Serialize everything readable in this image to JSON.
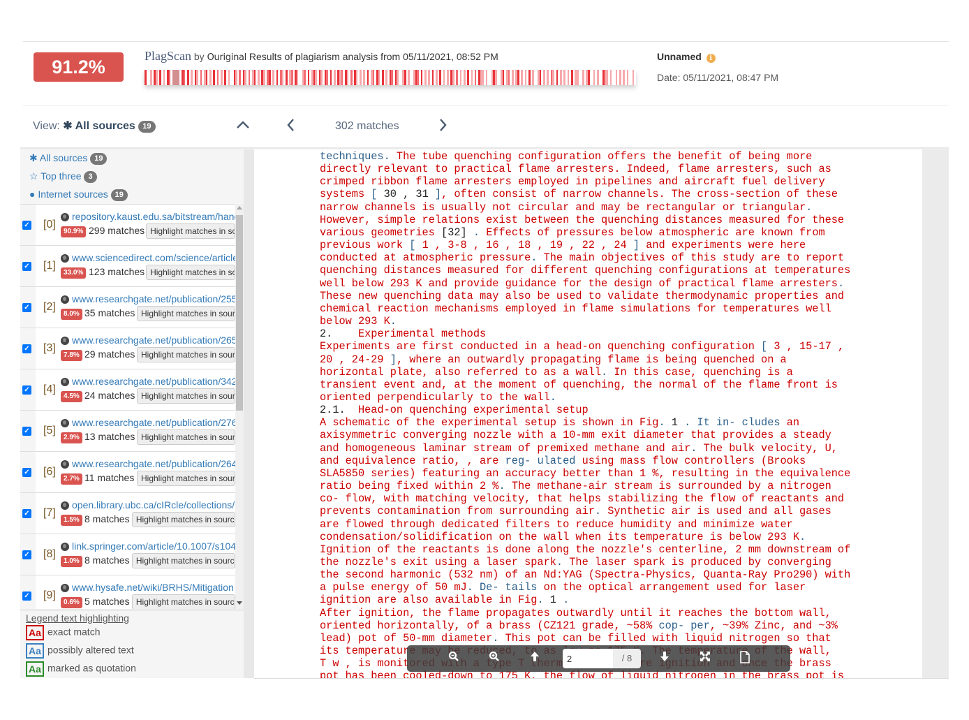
{
  "header": {
    "score": "91.2%",
    "brand_logo": "PlagScan",
    "brand_by": "by",
    "brand_ouriginal": "Ouriginal",
    "results_text": "Results of plagiarism analysis from 05/11/2021, 08:52 PM",
    "doc_name": "Unnamed",
    "info_icon": "info-icon",
    "doc_date": "Date: 05/11/2021, 08:47 PM",
    "heatbar_colors": {
      "strong": "#e8343a",
      "medium": "#f36d73",
      "light": "#f7a9ac",
      "grey": "#d48f91",
      "none": "#ffffff"
    }
  },
  "toolbar": {
    "view_prefix": "View:",
    "view_icon": "asterisk-icon",
    "view_value": "All sources",
    "view_count": "19",
    "collapse_icon": "chevron-up-icon",
    "prev_icon": "chevron-left-icon",
    "matches": "302 matches",
    "next_icon": "chevron-right-icon"
  },
  "filters": [
    {
      "icon": "✱",
      "label": "All sources",
      "count": "19"
    },
    {
      "icon": "☆",
      "label": "Top three",
      "count": "3"
    },
    {
      "icon": "●",
      "label": "Internet sources",
      "count": "19"
    }
  ],
  "sources": [
    {
      "index": "[0]",
      "url": "repository.kaust.edu.sa/bitstream/handle",
      "percent": "90.9%",
      "matches": "299 matches",
      "button": "Highlight matches in source",
      "checked": true
    },
    {
      "index": "[1]",
      "url": "www.sciencedirect.com/science/article",
      "percent": "33.0%",
      "matches": "123 matches",
      "button": "Highlight matches in source",
      "checked": true
    },
    {
      "index": "[2]",
      "url": "www.researchgate.net/publication/255",
      "percent": "8.0%",
      "matches": "35 matches",
      "button": "Highlight matches in source",
      "checked": true
    },
    {
      "index": "[3]",
      "url": "www.researchgate.net/publication/265",
      "percent": "7.8%",
      "matches": "29 matches",
      "button": "Highlight matches in source",
      "checked": true
    },
    {
      "index": "[4]",
      "url": "www.researchgate.net/publication/342",
      "percent": "4.5%",
      "matches": "24 matches",
      "button": "Highlight matches in source",
      "checked": true
    },
    {
      "index": "[5]",
      "url": "www.researchgate.net/publication/276",
      "percent": "2.9%",
      "matches": "13 matches",
      "button": "Highlight matches in source",
      "checked": true
    },
    {
      "index": "[6]",
      "url": "www.researchgate.net/publication/264",
      "percent": "2.7%",
      "matches": "11 matches",
      "button": "Highlight matches in source",
      "checked": true
    },
    {
      "index": "[7]",
      "url": "open.library.ubc.ca/cIRcle/collections/",
      "percent": "1.5%",
      "matches": "8 matches",
      "button": "Highlight matches in source",
      "checked": true
    },
    {
      "index": "[8]",
      "url": "link.springer.com/article/10.1007/s104",
      "percent": "1.0%",
      "matches": "8 matches",
      "button": "Highlight matches in source",
      "checked": true
    },
    {
      "index": "[9]",
      "url": "www.hysafe.net/wiki/BRHS/Mitigation",
      "percent": "0.6%",
      "matches": "5 matches",
      "button": "Highlight matches in source",
      "checked": true
    }
  ],
  "legend": {
    "title": "Legend text highlighting",
    "sample": "Aa",
    "items": [
      {
        "label": "exact match",
        "color": "#cc0000"
      },
      {
        "label": "possibly altered text",
        "color": "#3a7fc0"
      },
      {
        "label": "marked as quotation",
        "color": "#2a8a2a"
      }
    ]
  },
  "document": {
    "lines": [
      [
        [
          "b",
          "techniques."
        ],
        [
          "r",
          " The tube quenching configuration offers the benefit of being more"
        ]
      ],
      [
        [
          "r",
          "directly relevant to practical flame arresters. Indeed, flame arresters, such as"
        ]
      ],
      [
        [
          "r",
          "crimped ribbon flame arresters employed in pipelines and aircraft fuel delivery"
        ]
      ],
      [
        [
          "r",
          "systems "
        ],
        [
          "b",
          "["
        ],
        [
          "k",
          " 30 , 31 "
        ],
        [
          "b",
          "]"
        ],
        [
          "r",
          ", often consist of narrow channels. The cross-section of these"
        ]
      ],
      [
        [
          "r",
          "narrow channels is usually not circular and may be rectangular or triangular"
        ],
        [
          "b",
          "."
        ]
      ],
      [
        [
          "r",
          "However, simple relations exist between the quenching distances measured for these"
        ]
      ],
      [
        [
          "r",
          "various geometries "
        ],
        [
          "k",
          "[32] "
        ],
        [
          "b",
          "."
        ],
        [
          "r",
          " Effects of pressures below atmospheric are known from"
        ]
      ],
      [
        [
          "r",
          "previous work "
        ],
        [
          "b",
          "["
        ],
        [
          "r",
          " 1 , 3-8 , 16 , 18 , 19 , 22 , 24 "
        ],
        [
          "b",
          "]"
        ],
        [
          "r",
          " and experiments were here"
        ]
      ],
      [
        [
          "r",
          "conducted at atmospheric pressure"
        ],
        [
          "b",
          "."
        ],
        [
          "r",
          " The main objectives of this study are to report"
        ]
      ],
      [
        [
          "r",
          "quenching distances measured for different quenching configurations at temperatures"
        ]
      ],
      [
        [
          "r",
          "well below 293 K and provide guidance for the design of practical flame arresters"
        ],
        [
          "b",
          "."
        ]
      ],
      [
        [
          "r",
          "These new quenching data may also be used to validate thermodynamic properties and"
        ]
      ],
      [
        [
          "r",
          "chemical reaction mechanisms employed in flame simulations for temperatures well"
        ]
      ],
      [
        [
          "r",
          "below 293 K"
        ],
        [
          "b",
          "."
        ]
      ],
      [
        [
          "k",
          "2.    "
        ],
        [
          "r",
          "Experimental methods"
        ]
      ],
      [
        [
          "r",
          "Experiments are first conducted in a head-on quenching configuration "
        ],
        [
          "b",
          "["
        ],
        [
          "r",
          " 3 , 15-17 ,"
        ]
      ],
      [
        [
          "r",
          "20 , 24-29 "
        ],
        [
          "b",
          "]"
        ],
        [
          "r",
          ", where an outwardly propagating flame is being quenched on a"
        ]
      ],
      [
        [
          "r",
          "horizontal plate, also referred to as a wall"
        ],
        [
          "b",
          "."
        ],
        [
          "r",
          " In this case, quenching is a"
        ]
      ],
      [
        [
          "r",
          "transient event and, at the moment of quenching, the normal of the flame front is"
        ]
      ],
      [
        [
          "r",
          "oriented perpendicularly to the wall"
        ],
        [
          "b",
          "."
        ]
      ],
      [
        [
          "k",
          "2.1.  "
        ],
        [
          "r",
          "Head-on quenching experimental setup"
        ]
      ],
      [
        [
          "r",
          "A schematic of the experimental setup is shown in Fig"
        ],
        [
          "b",
          "."
        ],
        [
          "k",
          " 1 "
        ],
        [
          "b",
          ". It in- "
        ],
        [
          "b",
          "cludes"
        ],
        [
          "r",
          " an"
        ]
      ],
      [
        [
          "r",
          "axisymmetric converging nozzle with a 10-mm exit diameter that provides a steady"
        ]
      ],
      [
        [
          "r",
          "and homogeneous laminar stream of premixed methane and air"
        ],
        [
          "b",
          "."
        ],
        [
          "r",
          " The bulk velocity, U,"
        ]
      ],
      [
        [
          "r",
          "and equivalence ratio, , are "
        ],
        [
          "b",
          "reg- ulated"
        ],
        [
          "r",
          " using mass flow controllers (Brooks"
        ]
      ],
      [
        [
          "r",
          "SLA5850 series) featuring an accuracy better than 1 %, resulting in the equivalence"
        ]
      ],
      [
        [
          "r",
          "ratio being fixed within 2 %"
        ],
        [
          "b",
          "."
        ],
        [
          "r",
          " The methane-air stream is surrounded by a nitrogen"
        ]
      ],
      [
        [
          "r",
          "co- flow, with matching velocity, that helps stabilizing the flow of reactants and"
        ]
      ],
      [
        [
          "r",
          "prevents contamination from surrounding air"
        ],
        [
          "b",
          "."
        ],
        [
          "r",
          " Synthetic air is used and all gases"
        ]
      ],
      [
        [
          "r",
          "are flowed through dedicated filters to reduce humidity and minimize water"
        ]
      ],
      [
        [
          "r",
          "condensation/solidification on the wall when its temperature is below 293 K"
        ],
        [
          "b",
          "."
        ]
      ],
      [
        [
          "r",
          "Ignition of the reactants is done along the nozzle's centerline, 2 mm downstream of"
        ]
      ],
      [
        [
          "r",
          "the nozzle's exit using a laser spark"
        ],
        [
          "b",
          "."
        ],
        [
          "r",
          " The laser spark is produced by converging"
        ]
      ],
      [
        [
          "r",
          "the second harmonic (532 nm) of an Nd:YAG (Spectra-Physics, Quanta-Ray Pro290) with"
        ]
      ],
      [
        [
          "r",
          "a pulse energy of 50 mJ"
        ],
        [
          "b",
          "."
        ],
        [
          "b",
          " De- tails"
        ],
        [
          "r",
          " on the optical arrangement used for laser"
        ]
      ],
      [
        [
          "r",
          "ignition are also available in Fig"
        ],
        [
          "b",
          "."
        ],
        [
          "k",
          " 1 "
        ],
        [
          "b",
          "."
        ]
      ],
      [
        [
          "r",
          "After ignition, the flame propagates outwardly until it reaches the bottom wall,"
        ]
      ],
      [
        [
          "r",
          "oriented horizontally, of a brass (CZ121 grade, ~58% "
        ],
        [
          "b",
          "cop- per"
        ],
        [
          "r",
          ", ~39% Zinc, and ~3%"
        ]
      ],
      [
        [
          "r",
          "lead) pot of 50-mm diameter"
        ],
        [
          "b",
          "."
        ],
        [
          "r",
          " This pot can be filled with liquid nitrogen so that"
        ]
      ],
      [
        [
          "r",
          "its temperature may be reduced, to as low as 175 K. The temperature of the wall,"
        ]
      ],
      [
        [
          "r",
          "T w , is monitored with a type T thermocouple before ignition and once the brass"
        ]
      ],
      [
        [
          "r",
          "pot has been cooled-down to 175 K, the flow of liquid nitrogen in the brass pot is"
        ]
      ]
    ]
  },
  "pdf_toolbar": {
    "zoom_out_icon": "zoom-out-icon",
    "zoom_in_icon": "zoom-in-icon",
    "prev_page_icon": "arrow-up-icon",
    "page_value": "2",
    "page_total": "/ 8",
    "next_page_icon": "arrow-down-icon",
    "fullscreen_icon": "expand-icon",
    "document_icon": "file-icon"
  }
}
